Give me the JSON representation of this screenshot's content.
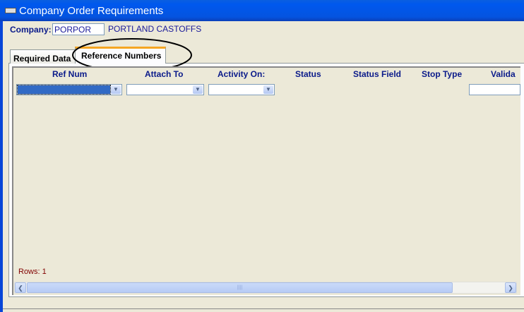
{
  "window": {
    "title": "Company Order Requirements"
  },
  "company": {
    "label": "Company:",
    "code": "PORPOR",
    "name": "PORTLAND CASTOFFS"
  },
  "tabs": [
    {
      "label": "Required Data",
      "active": false
    },
    {
      "label": "Reference Numbers",
      "active": true
    }
  ],
  "grid": {
    "columns": [
      "Ref Num",
      "Attach To",
      "Activity On:",
      "Status",
      "Status Field",
      "Stop Type",
      "Valida"
    ],
    "rows": [
      {
        "ref_num": "",
        "attach_to": "",
        "activity_on": "",
        "validation": ""
      }
    ],
    "rows_label": "Rows: 1"
  },
  "colors": {
    "title_bar": "#0058ee",
    "header_text": "#0a1a8a",
    "rows_text": "#800000",
    "selection": "#316ac5",
    "annotation": "#000000"
  },
  "icons": [
    "app-icon",
    "chevron-down-icon",
    "scroll-left-icon",
    "scroll-right-icon"
  ]
}
